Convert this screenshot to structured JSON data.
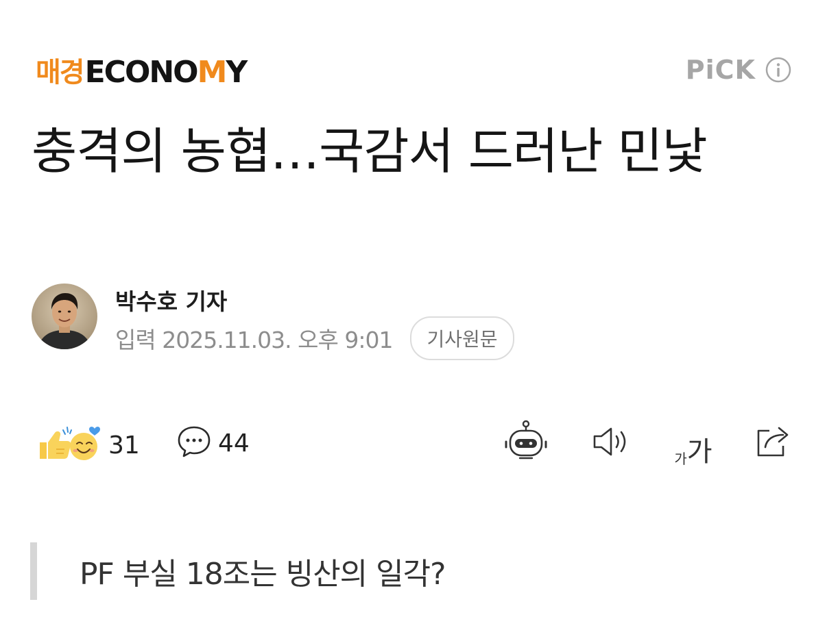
{
  "brand": {
    "prefix": "매경",
    "name_part1": "ECONO",
    "name_highlight": "M",
    "name_part2": "Y",
    "accent_color": "#f08a1d"
  },
  "pick": {
    "label": "PiCK",
    "icon": "info-circle-icon"
  },
  "article": {
    "headline": "충격의 농협…국감서 드러난 민낯",
    "author": "박수호 기자",
    "date_line": "입력 2025.11.03. 오후 9:01",
    "original_button": "기사원문",
    "subheading": "PF 부실 18조는 빙산의 일각?"
  },
  "actions": {
    "reaction_count": "31",
    "reaction_icon": "emoji-reaction-icon",
    "comment_count": "44",
    "comment_icon": "comment-bubble-icon",
    "tools": [
      {
        "name": "ai-summary-bot-icon"
      },
      {
        "name": "speaker-icon"
      },
      {
        "name": "font-size-icon",
        "small": "가",
        "big": "가"
      },
      {
        "name": "share-icon"
      }
    ]
  }
}
